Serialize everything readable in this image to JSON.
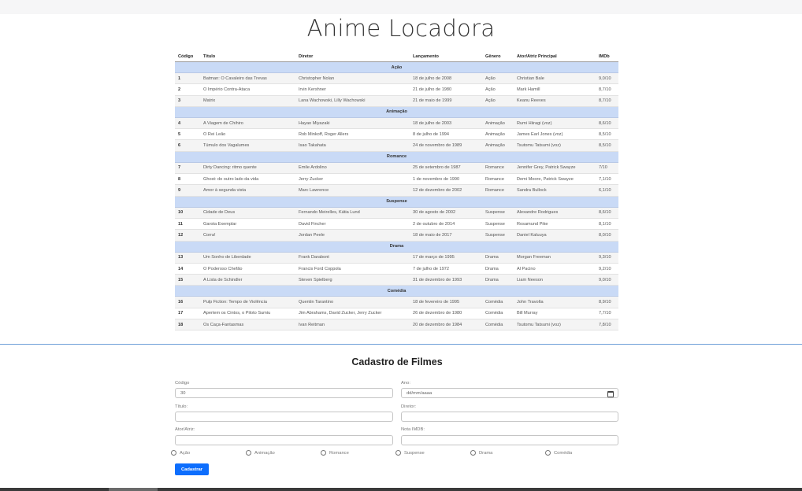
{
  "app": {
    "title": "Anime Locadora"
  },
  "table": {
    "headers": [
      "Código",
      "Título",
      "Diretor",
      "Lançamento",
      "Gênero",
      "Ator/Atriz Principal",
      "IMDb"
    ],
    "groups": [
      {
        "category": "Ação",
        "rows": [
          [
            "1",
            "Batman: O Cavaleiro das Trevas",
            "Christopher Nolan",
            "18 de julho de 2008",
            "Ação",
            "Christian Bale",
            "9,0/10"
          ],
          [
            "2",
            "O Império Contra-Ataca",
            "Irvin Kershner",
            "21 de julho de 1980",
            "Ação",
            "Mark Hamill",
            "8,7/10"
          ],
          [
            "3",
            "Matrix",
            "Lana Wachowski, Lilly Wachowski",
            "21 de maio de 1999",
            "Ação",
            "Keanu Reeves",
            "8,7/10"
          ]
        ]
      },
      {
        "category": "Animação",
        "rows": [
          [
            "4",
            "A Viagem de Chihiro",
            "Hayao Miyazaki",
            "18 de julho de 2003",
            "Animação",
            "Rumi Hiiragi (voz)",
            "8,6/10"
          ],
          [
            "5",
            "O Rei Leão",
            "Rob Minkoff, Roger Allers",
            "8 de julho de 1994",
            "Animação",
            "James Earl Jones (voz)",
            "8,5/10"
          ],
          [
            "6",
            "Túmulo dos Vagalumes",
            "Isao Takahata",
            "24 de novembro de 1989",
            "Animação",
            "Tsutomu Tatsumi (voz)",
            "8,5/10"
          ]
        ]
      },
      {
        "category": "Romance",
        "rows": [
          [
            "7",
            "Dirty Dancing: ritmo quente",
            "Emile Ardolino",
            "25 de setembro de 1987",
            "Romance",
            "Jennifer Grey, Patrick Swayze",
            "7/10"
          ],
          [
            "8",
            "Ghost: do outro lado da vida",
            "Jerry Zucker",
            "1 de novembro de 1990",
            "Romance",
            "Demi Moore, Patrick Swayze",
            "7,1/10"
          ],
          [
            "9",
            "Amor à segunda vista",
            "Marc Lawrence",
            "12 de dezembro de 2002",
            "Romance",
            "Sandra Bullock",
            "6,1/10"
          ]
        ]
      },
      {
        "category": "Suspense",
        "rows": [
          [
            "10",
            "Cidade de Deus",
            "Fernando Meirelles, Kátia Lund",
            "30 de agosto de 2002",
            "Suspense",
            "Alexandre Rodrigues",
            "8,6/10"
          ],
          [
            "11",
            "Garota Exemplar",
            "David Fincher",
            "2 de outubro de 2014",
            "Suspense",
            "Rosamund Pike",
            "8,1/10"
          ],
          [
            "12",
            "Corra!",
            "Jordan Peele",
            "18 de maio de 2017",
            "Suspense",
            "Daniel Kaluuya",
            "8,0/10"
          ]
        ]
      },
      {
        "category": "Drama",
        "rows": [
          [
            "13",
            "Um Sonho de Liberdade",
            "Frank Darabont",
            "17 de março de 1995",
            "Drama",
            "Morgan Freeman",
            "9,3/10"
          ],
          [
            "14",
            "O Poderoso Chefão",
            "Francis Ford Coppola",
            "7 de julho de 1972",
            "Drama",
            "Al Pacino",
            "9,2/10"
          ],
          [
            "15",
            "A Lista de Schindler",
            "Steven Spielberg",
            "31 de dezembro de 1993",
            "Drama",
            "Liam Neeson",
            "9,0/10"
          ]
        ]
      },
      {
        "category": "Comédia",
        "rows": [
          [
            "16",
            "Pulp Fiction: Tempo de Violência",
            "Quentin Tarantino",
            "18 de fevereiro de 1995",
            "Comédia",
            "John Travolta",
            "8,9/10"
          ],
          [
            "17",
            "Apertem os Cintos, o Piloto Sumiu",
            "Jim Abrahams, David Zucker, Jerry Zucker",
            "26 de dezembro de 1980",
            "Comédia",
            "Bill Murray",
            "7,7/10"
          ],
          [
            "18",
            "Os Caça-Fantasmas",
            "Ivan Reitman",
            "20 de dezembro de 1984",
            "Comédia",
            "Tsutomu Tatsumi (voz)",
            "7,8/10"
          ]
        ]
      }
    ]
  },
  "form": {
    "title": "Cadastro de Filmes",
    "codigo_label": "Código",
    "codigo_value": "30",
    "ano_label": "Ano:",
    "ano_placeholder": "dd/mm/aaaa",
    "titulo_label": "Título:",
    "diretor_label": "Diretor:",
    "ator_label": "Ator/Atriz:",
    "nota_label": "Nota IMDB:",
    "genres": [
      "Ação",
      "Animação",
      "Romance",
      "Suspense",
      "Drama",
      "Comédia"
    ],
    "submit_label": "Cadastrar"
  },
  "colors": {
    "category_row": "#c9daf6",
    "accent": "#0d6efd",
    "divider": "#6f9fd8"
  }
}
